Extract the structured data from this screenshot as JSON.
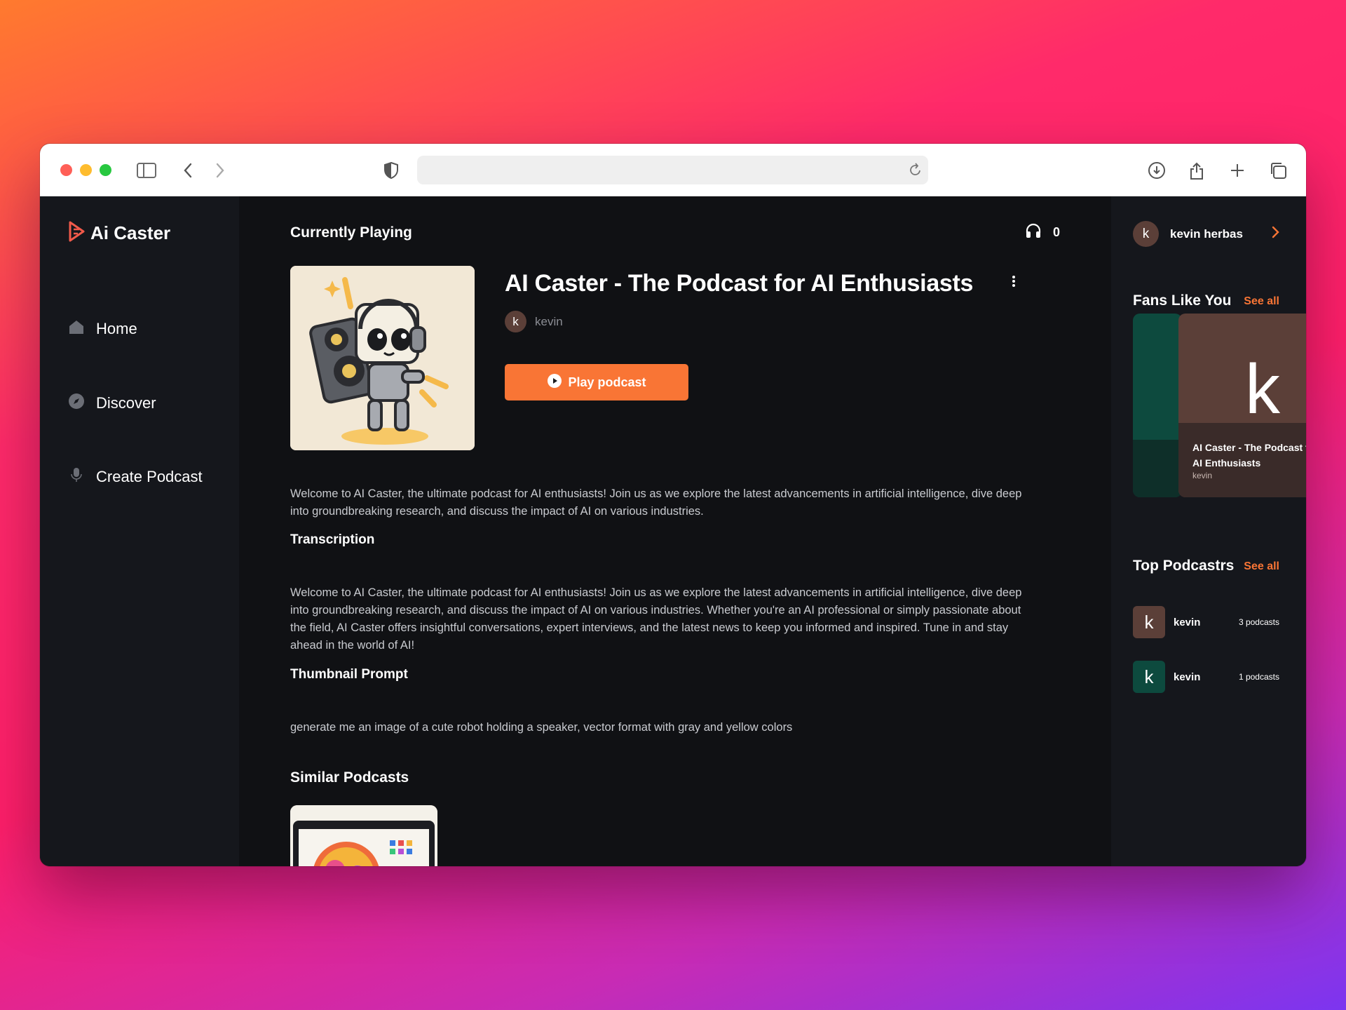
{
  "app": {
    "name": "Ai Caster"
  },
  "nav": [
    {
      "label": "Home"
    },
    {
      "label": "Discover"
    },
    {
      "label": "Create Podcast"
    }
  ],
  "main": {
    "currently_playing_label": "Currently Playing",
    "listen_count": "0",
    "podcast_title": "AI Caster - The Podcast for AI Enthusiasts",
    "author_initial": "k",
    "author_name": "kevin",
    "play_label": "Play podcast",
    "description": "Welcome to AI Caster, the ultimate podcast for AI enthusiasts! Join us as we explore the latest advancements in artificial intelligence, dive deep into groundbreaking research, and discuss the impact of AI on various industries.",
    "transcription_heading": "Transcription",
    "transcription": "Welcome to AI Caster, the ultimate podcast for AI enthusiasts! Join us as we explore the latest advancements in artificial intelligence, dive deep into groundbreaking research, and discuss the impact of AI on various industries. Whether you're an AI professional or simply passionate about the field, AI Caster offers insightful conversations, expert interviews, and the latest news to keep you informed and inspired. Tune in and stay ahead in the world of AI!",
    "thumbnail_prompt_heading": "Thumbnail Prompt",
    "thumbnail_prompt": "generate me an image of a cute robot holding a speaker, vector format with gray and yellow colors",
    "similar_heading": "Similar Podcasts"
  },
  "right": {
    "user_initial": "k",
    "user_name": "kevin herbas",
    "fans_heading": "Fans Like You",
    "fans_see_all": "See all",
    "fan_card": {
      "initial": "k",
      "title": "AI Caster - The Podcast for AI Enthusiasts",
      "author": "kevin"
    },
    "top_heading": "Top Podcastrs",
    "top_see_all": "See all",
    "top": [
      {
        "initial": "k",
        "name": "kevin",
        "count": "3 podcasts",
        "color": "#5b3f38"
      },
      {
        "initial": "k",
        "name": "kevin",
        "count": "1 podcasts",
        "color": "#0d4a3e"
      }
    ]
  },
  "colors": {
    "accent": "#f97535",
    "sidebar": "#15171c",
    "main_bg": "#101114"
  }
}
